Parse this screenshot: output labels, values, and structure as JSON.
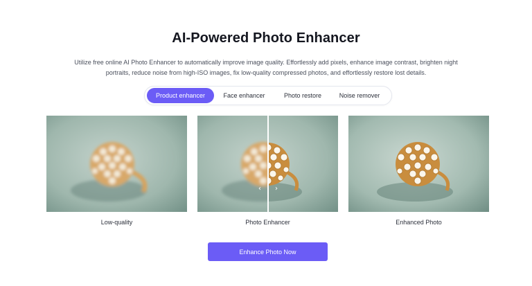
{
  "page": {
    "title": "AI-Powered Photo Enhancer",
    "description": "Utilize free online AI Photo Enhancer to automatically improve image quality. Effortlessly add pixels, enhance image contrast, brighten night portraits, reduce noise from high-ISO images, fix low-quality compressed photos, and effortlessly restore lost details."
  },
  "tabs": [
    {
      "label": "Product enhancer",
      "active": true
    },
    {
      "label": "Face enhancer",
      "active": false
    },
    {
      "label": "Photo restore",
      "active": false
    },
    {
      "label": "Noise remover",
      "active": false
    }
  ],
  "samples": [
    {
      "caption": "Low-quality"
    },
    {
      "caption": "Photo Enhancer"
    },
    {
      "caption": "Enhanced Photo"
    }
  ],
  "compare_handle": {
    "left_icon": "chevron-left-icon",
    "right_icon": "chevron-right-icon"
  },
  "cta": {
    "label": "Enhance Photo Now"
  },
  "colors": {
    "accent": "#6b5cf6",
    "photo_bg": "#a7bdb4"
  }
}
